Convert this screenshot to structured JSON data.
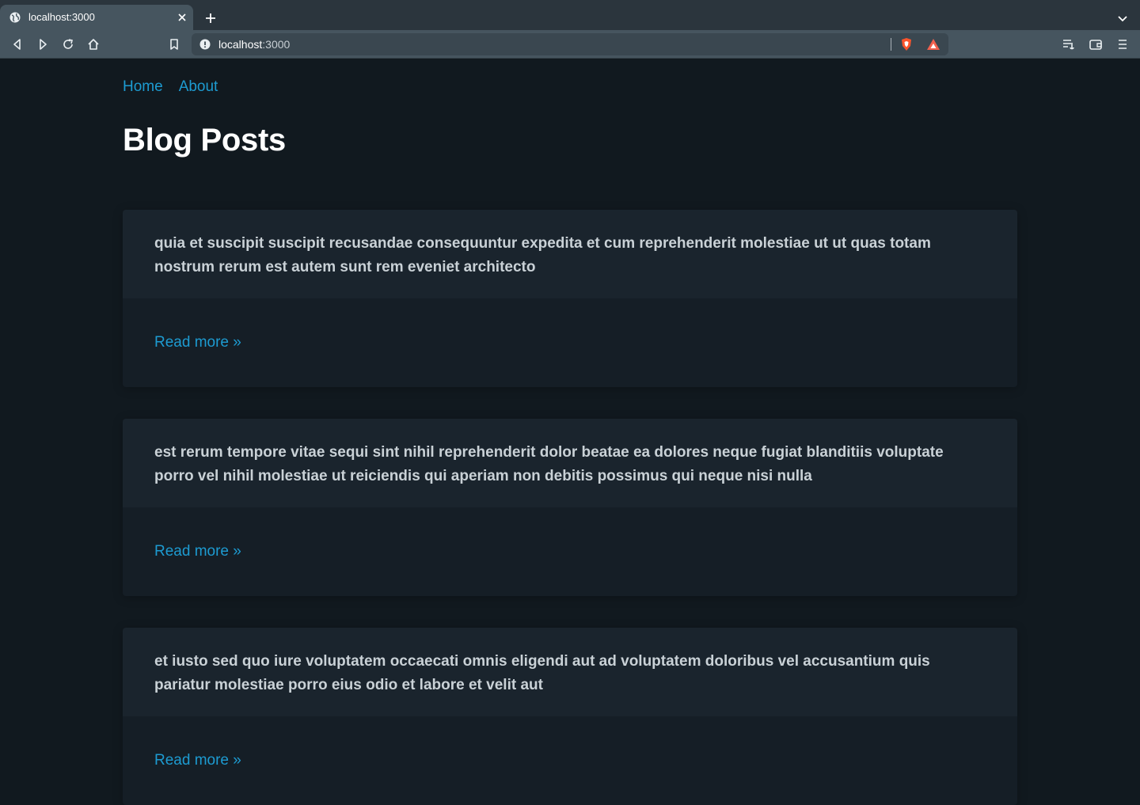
{
  "browser": {
    "tab_title": "localhost:3000",
    "url_host": "localhost",
    "url_port": ":3000",
    "icons": {
      "back": "back-icon",
      "forward": "forward-icon",
      "reload": "reload-icon",
      "home": "home-icon",
      "bookmark": "bookmark-icon",
      "shield": "brave-shield-icon",
      "rewards": "brave-rewards-icon",
      "playlist": "playlist-icon",
      "wallet": "wallet-icon",
      "menu": "menu-icon"
    }
  },
  "nav": {
    "home": "Home",
    "about": "About"
  },
  "main": {
    "title": "Blog Posts",
    "posts": [
      {
        "title": "quia et suscipit suscipit recusandae consequuntur expedita et cum reprehenderit molestiae ut ut quas totam nostrum rerum est autem sunt rem eveniet architecto",
        "link": "Read more »"
      },
      {
        "title": "est rerum tempore vitae sequi sint nihil reprehenderit dolor beatae ea dolores neque fugiat blanditiis voluptate porro vel nihil molestiae ut reiciendis qui aperiam non debitis possimus qui neque nisi nulla",
        "link": "Read more »"
      },
      {
        "title": "et iusto sed quo iure voluptatem occaecati omnis eligendi aut ad voluptatem doloribus vel accusantium quis pariatur molestiae porro eius odio et labore et velit aut",
        "link": "Read more »"
      }
    ]
  },
  "colors": {
    "background": "#11191f",
    "link": "#1d9bd1",
    "card": "#1a242d",
    "heading": "#ffffff"
  }
}
